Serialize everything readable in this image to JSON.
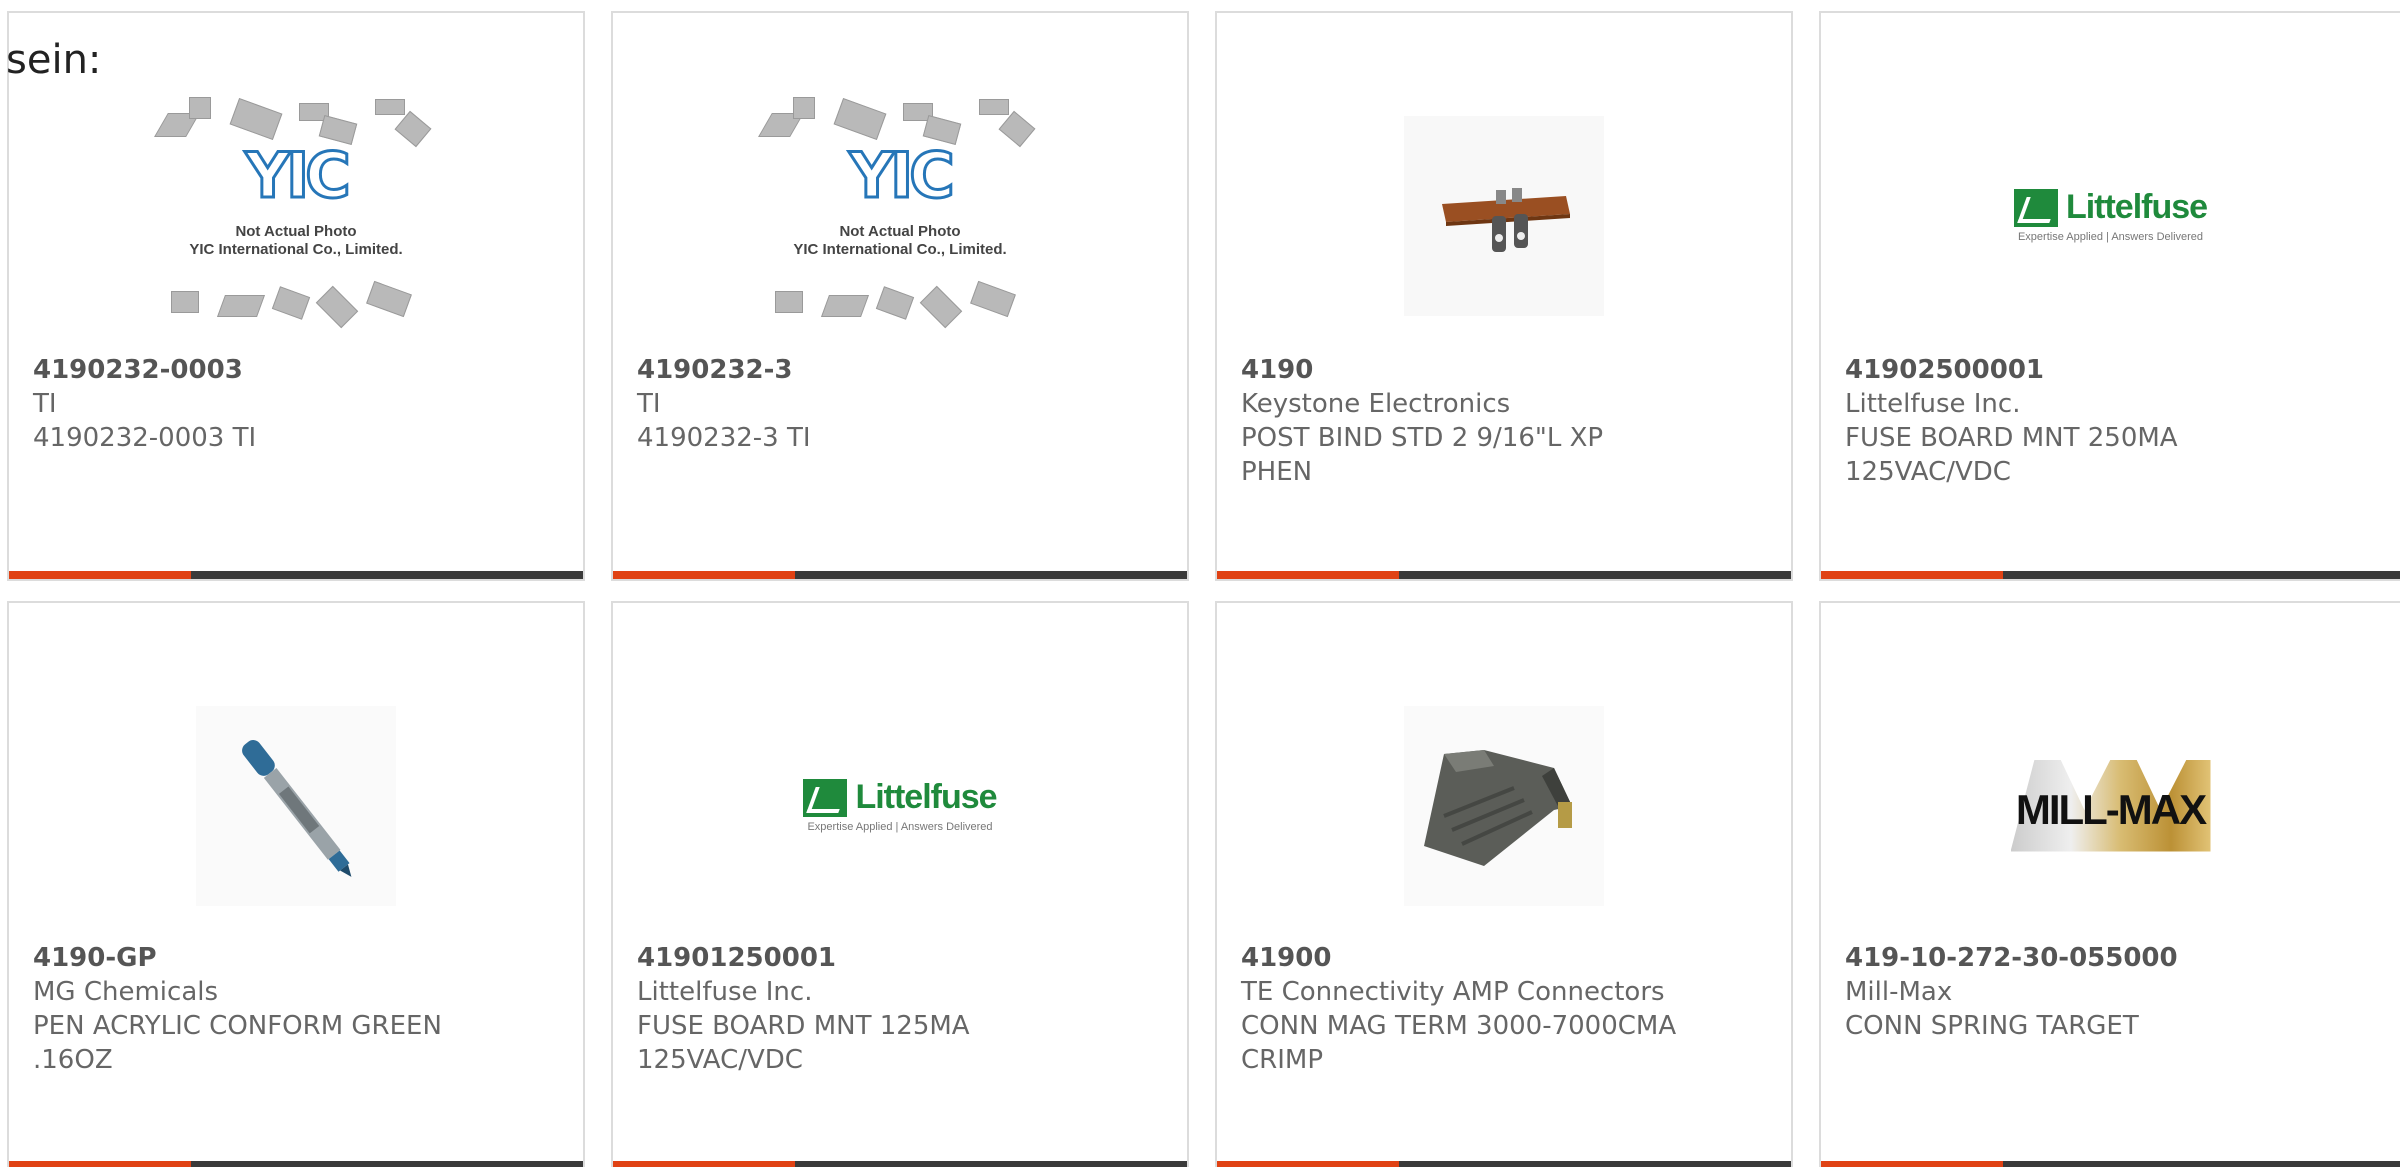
{
  "intro_text": "sein:",
  "products": [
    {
      "part_number": "4190232-0003",
      "manufacturer": "TI",
      "description_line1": "4190232-0003 TI",
      "description_line2": "",
      "image": "yic-placeholder",
      "image_caption_line1": "Not Actual Photo",
      "image_caption_line2": "YIC International Co., Limited.",
      "image_logo_text": "YIC"
    },
    {
      "part_number": "4190232-3",
      "manufacturer": "TI",
      "description_line1": "4190232-3 TI",
      "description_line2": "",
      "image": "yic-placeholder",
      "image_caption_line1": "Not Actual Photo",
      "image_caption_line2": "YIC International Co., Limited.",
      "image_logo_text": "YIC"
    },
    {
      "part_number": "4190",
      "manufacturer": "Keystone Electronics",
      "description_line1": "POST BIND STD 2 9/16\"L XP",
      "description_line2": "PHEN",
      "image": "binding-post-photo"
    },
    {
      "part_number": "41902500001",
      "manufacturer": "Littelfuse Inc.",
      "description_line1": "FUSE BOARD MNT 250MA",
      "description_line2": "125VAC/VDC",
      "image": "littelfuse-logo",
      "logo_name": "Littelfuse",
      "logo_tagline": "Expertise Applied | Answers Delivered"
    },
    {
      "part_number": "4190-GP",
      "manufacturer": "MG Chemicals",
      "description_line1": "PEN ACRYLIC CONFORM GREEN",
      "description_line2": ".16OZ",
      "image": "pen-photo"
    },
    {
      "part_number": "41901250001",
      "manufacturer": "Littelfuse Inc.",
      "description_line1": "FUSE BOARD MNT 125MA",
      "description_line2": "125VAC/VDC",
      "image": "littelfuse-logo",
      "logo_name": "Littelfuse",
      "logo_tagline": "Expertise Applied | Answers Delivered"
    },
    {
      "part_number": "41900",
      "manufacturer": "TE Connectivity AMP Connectors",
      "description_line1": "CONN MAG TERM 3000-7000CMA",
      "description_line2": "CRIMP",
      "image": "connector-photo"
    },
    {
      "part_number": "419-10-272-30-055000",
      "manufacturer": "Mill-Max",
      "description_line1": "CONN SPRING TARGET",
      "description_line2": "",
      "image": "mill-max-logo",
      "logo_name": "MILL-MAX"
    }
  ],
  "colors": {
    "accent": "#e04214",
    "bar": "#3a3a3a",
    "border": "#dcdcdc",
    "text": "#666666"
  }
}
